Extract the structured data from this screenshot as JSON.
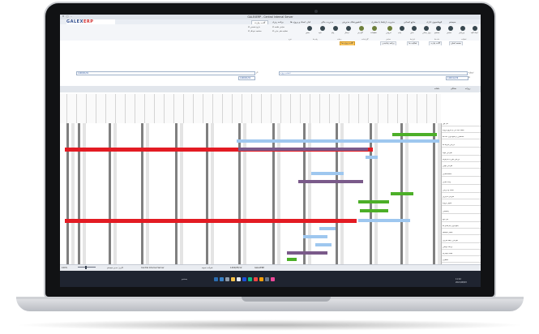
{
  "window": {
    "title": "GALEXERP - Central Internal Server",
    "controls": [
      "–",
      "□",
      "✕"
    ]
  },
  "logo": {
    "main": "GALEX",
    "accent": "ERP"
  },
  "tabs": [
    {
      "label": "سیستم",
      "active": false
    },
    {
      "label": "اتوماسیون اداری",
      "active": false
    },
    {
      "label": "منابع انسانی",
      "active": false
    },
    {
      "label": "مدیریت ارتباط با مشتری",
      "active": false
    },
    {
      "label": "داشبوردهای مدیریتی",
      "active": false
    },
    {
      "label": "مدیریت مالی",
      "active": false
    },
    {
      "label": "انبار، اسناد و پروژه ها",
      "active": false
    },
    {
      "label": "برنامه ریزی",
      "active": false
    },
    {
      "label": "گانت چارت",
      "active": true
    }
  ],
  "ribbon": {
    "items": [
      {
        "label": "ایجاد کلید",
        "color": "#37474f"
      },
      {
        "label": "ویرایش",
        "color": "#37474f"
      },
      {
        "label": "نمایش",
        "color": "#37474f"
      },
      {
        "label": "جستجو",
        "color": "#37474f"
      },
      {
        "label": "بروز رسانی",
        "color": "#37474f"
      },
      {
        "label": "حذف",
        "color": "#37474f"
      },
      {
        "label": "چاپ",
        "color": "#37474f"
      },
      {
        "label": "خروجی",
        "color": "#6d7f3b"
      },
      {
        "label": "تنظیمات",
        "color": "#6d7f3b"
      },
      {
        "label": "گزارش",
        "color": "#6d7f3b"
      },
      {
        "label": "ارسال",
        "color": "#37474f"
      },
      {
        "label": "پیام",
        "color": "#37474f"
      },
      {
        "label": "تایید",
        "color": "#37474f"
      },
      {
        "label": "بستن",
        "color": "#37474f"
      }
    ],
    "checks": [
      "نمایش خلاصه",
      "فعالیت های جاری",
      "تاریخ شمسی",
      "محاسبه خودکار"
    ],
    "groups": [
      "عملیات",
      "داده ها",
      "ابزارها",
      "نمایش",
      "گزارشات",
      "رسانه",
      "پیام ها",
      "فرم"
    ]
  },
  "toolbar": {
    "buttons": [
      {
        "label": "صفحه اصلی",
        "orange": false
      },
      {
        "label": "گانت چارت",
        "orange": false
      },
      {
        "label": "فعالیت ها",
        "orange": false
      },
      {
        "label": "برنامه زمانبندی",
        "orange": false
      },
      {
        "label": "گانت پروژه ها",
        "orange": true
      }
    ]
  },
  "fields": {
    "project_label": "پروژه:",
    "project_value": "انتخاب پروژه",
    "from_label": "از:",
    "from_value": "1400/01/01",
    "to_label": "تا:",
    "to_value": "1400/12/29"
  },
  "filter": {
    "text1": "روزانه",
    "text2": "هفتگی",
    "text3": "ماهانه"
  },
  "tasks": [
    "فاز اول",
    "جلسه کیک آف و شروع پروژه",
    "شناسایی و جمع آوری داده ها",
    "ارزیابی فرآیند ها",
    "طراحی اولیه",
    "بررسی طرح با کارفرما",
    "طراحی نهایی",
    "مستندسازی",
    "پیاده سازی",
    "تست و ارزیابی",
    "آموزش کاربران",
    "تحویل پروژه",
    "پشتیبانی",
    "فاز دوم",
    "جمع آوری نیازمندی ها",
    "تحلیل سیستم",
    "طراحی رابط کاربری",
    "برنامه نویسی",
    "تست یکپارچه",
    "استقرار"
  ],
  "bar_colors": {
    "green": "#4caf28",
    "lightblue": "#9ec7ef",
    "purple": "#7a5a8a",
    "red": "#e31b23"
  },
  "status": {
    "zoom": "100%",
    "user": "کاربر: مدیر سیستم",
    "server": "Central Internal Server",
    "company": "شرکت نمونه",
    "date": "1400/05/12",
    "db": "GalexERP"
  },
  "taskbar": {
    "search": "جستجو",
    "time": "11:42",
    "date": "2021/08/03"
  }
}
